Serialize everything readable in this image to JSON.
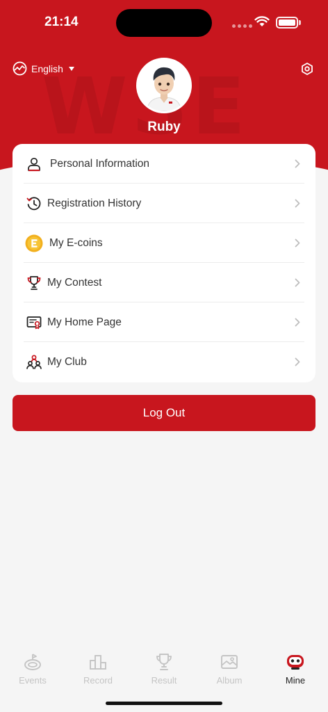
{
  "status": {
    "time": "21:14"
  },
  "header": {
    "language": "English",
    "watermark": "WSE",
    "username": "Ruby"
  },
  "menu": {
    "items": [
      {
        "label": "Personal Information",
        "icon": "person-icon"
      },
      {
        "label": "Registration History",
        "icon": "history-icon"
      },
      {
        "label": "My E-coins",
        "icon": "ecoin-icon"
      },
      {
        "label": "My Contest",
        "icon": "trophy-icon"
      },
      {
        "label": "My Home Page",
        "icon": "certificate-icon"
      },
      {
        "label": "My Club",
        "icon": "club-icon"
      }
    ]
  },
  "logout": {
    "label": "Log Out"
  },
  "tabs": [
    {
      "label": "Events",
      "icon": "events-icon"
    },
    {
      "label": "Record",
      "icon": "record-icon"
    },
    {
      "label": "Result",
      "icon": "result-icon"
    },
    {
      "label": "Album",
      "icon": "album-icon"
    },
    {
      "label": "Mine",
      "icon": "mine-icon"
    }
  ],
  "colors": {
    "accent": "#c8161e",
    "ecoin": "#f2b01e"
  }
}
